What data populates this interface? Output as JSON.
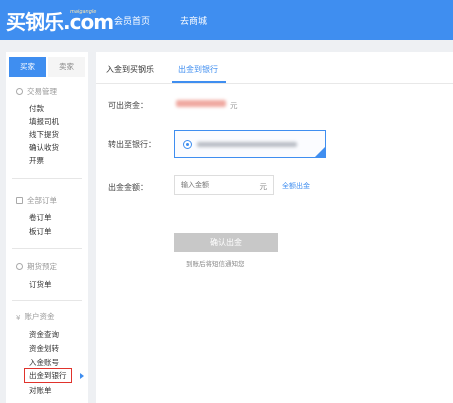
{
  "header": {
    "logo": "买钢乐.com",
    "logo_sub": "maigangle",
    "nav": [
      "会员首页",
      "去商城"
    ]
  },
  "sidebar": {
    "tabs": [
      "买家",
      "卖家"
    ],
    "groups": [
      {
        "title": "交易管理",
        "items": [
          "付款",
          "填报司机",
          "线下提货",
          "确认收货",
          "开票"
        ]
      },
      {
        "title": "全部订单",
        "items": [
          "卷订单",
          "板订单"
        ]
      },
      {
        "title": "期货预定",
        "items": [
          "订货单"
        ]
      },
      {
        "title": "账户资金",
        "items": [
          "资金查询",
          "资金划转",
          "入金账号",
          "出金到银行",
          "对账单"
        ]
      }
    ]
  },
  "main": {
    "tabs": [
      "入金到买钢乐",
      "出金到银行"
    ],
    "available_label": "可出资金：",
    "available_unit": "元",
    "bank_label": "转出至银行：",
    "amount_label": "出金金额：",
    "amount_placeholder": "输入金额",
    "amount_unit": "元",
    "all_link": "全额出金",
    "confirm": "确认出金",
    "hint": "到账后将短信通知您"
  }
}
